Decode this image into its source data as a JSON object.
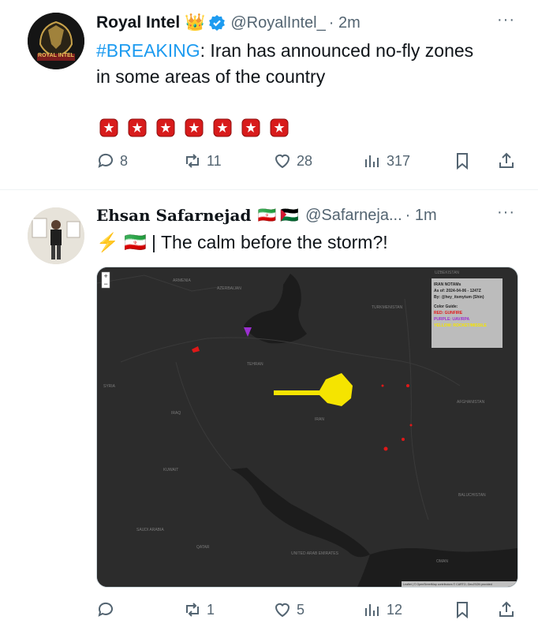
{
  "tweets": [
    {
      "display_name": "Royal Intel",
      "emoji": "👑",
      "handle": "@RoyalIntel_",
      "time": "· 2m",
      "more": "···",
      "hashtag": "#BREAKING",
      "text_line1": ": Iran has announced no-fly zones",
      "text_line2": "in some areas of the country",
      "siren_count": 7,
      "avatar_text": "ROYAL INTEL",
      "stats": {
        "replies": "8",
        "reposts": "11",
        "likes": "28",
        "views": "317"
      }
    },
    {
      "display_name": "Ehsan Safarnejad",
      "flags": "🇮🇷 🇵🇸",
      "handle": "@Safarneja...",
      "time": "· 1m",
      "more": "···",
      "text": "⚡ 🇮🇷 | The calm before the storm?!",
      "stats": {
        "replies": "",
        "reposts": "1",
        "likes": "5",
        "views": "12"
      },
      "map": {
        "legend_title": "IRAN NOTAMs",
        "legend_asof": "As of: 2024-04-06 - 1247Z",
        "legend_by": "By: @hey_itsmytum (Shin)",
        "legend_guide": "Color Guide:",
        "legend_red": "RED: GUNFIRE",
        "legend_purple": "PURPLE: UAV/RPA",
        "legend_yellow": "YELLOW: ROCKET/MISSILE",
        "attribution": "Leaflet | © OpenStreetMap contributors © CARTO, GeoJSON provided",
        "zoom_in": "+",
        "zoom_out": "−",
        "labels": [
          "ARMENIA",
          "AZERBAIJAN",
          "TURKMENISTAN",
          "UZBEKISTAN",
          "SYRIA",
          "IRAQ",
          "IRAN",
          "AFGHANISTAN",
          "KUWAIT",
          "SAUDI ARABIA",
          "QATAR",
          "UNITED ARAB EMIRATES",
          "OMAN",
          "BALUCHISTAN",
          "TEHRAN"
        ]
      }
    }
  ],
  "colors": {
    "link": "#1d9bf0",
    "muted": "#536471",
    "verified": "#1d9bf0",
    "crown": "#f4b400",
    "notam_red": "#e01818",
    "notam_purple": "#9b2fd0",
    "notam_yellow": "#f5e400"
  }
}
